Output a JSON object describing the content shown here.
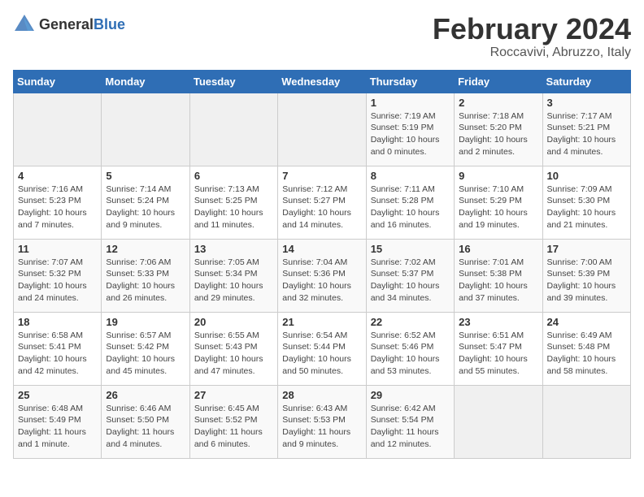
{
  "header": {
    "logo_general": "General",
    "logo_blue": "Blue",
    "title": "February 2024",
    "subtitle": "Roccavivi, Abruzzo, Italy"
  },
  "calendar": {
    "columns": [
      "Sunday",
      "Monday",
      "Tuesday",
      "Wednesday",
      "Thursday",
      "Friday",
      "Saturday"
    ],
    "weeks": [
      [
        {
          "day": "",
          "info": ""
        },
        {
          "day": "",
          "info": ""
        },
        {
          "day": "",
          "info": ""
        },
        {
          "day": "",
          "info": ""
        },
        {
          "day": "1",
          "info": "Sunrise: 7:19 AM\nSunset: 5:19 PM\nDaylight: 10 hours\nand 0 minutes."
        },
        {
          "day": "2",
          "info": "Sunrise: 7:18 AM\nSunset: 5:20 PM\nDaylight: 10 hours\nand 2 minutes."
        },
        {
          "day": "3",
          "info": "Sunrise: 7:17 AM\nSunset: 5:21 PM\nDaylight: 10 hours\nand 4 minutes."
        }
      ],
      [
        {
          "day": "4",
          "info": "Sunrise: 7:16 AM\nSunset: 5:23 PM\nDaylight: 10 hours\nand 7 minutes."
        },
        {
          "day": "5",
          "info": "Sunrise: 7:14 AM\nSunset: 5:24 PM\nDaylight: 10 hours\nand 9 minutes."
        },
        {
          "day": "6",
          "info": "Sunrise: 7:13 AM\nSunset: 5:25 PM\nDaylight: 10 hours\nand 11 minutes."
        },
        {
          "day": "7",
          "info": "Sunrise: 7:12 AM\nSunset: 5:27 PM\nDaylight: 10 hours\nand 14 minutes."
        },
        {
          "day": "8",
          "info": "Sunrise: 7:11 AM\nSunset: 5:28 PM\nDaylight: 10 hours\nand 16 minutes."
        },
        {
          "day": "9",
          "info": "Sunrise: 7:10 AM\nSunset: 5:29 PM\nDaylight: 10 hours\nand 19 minutes."
        },
        {
          "day": "10",
          "info": "Sunrise: 7:09 AM\nSunset: 5:30 PM\nDaylight: 10 hours\nand 21 minutes."
        }
      ],
      [
        {
          "day": "11",
          "info": "Sunrise: 7:07 AM\nSunset: 5:32 PM\nDaylight: 10 hours\nand 24 minutes."
        },
        {
          "day": "12",
          "info": "Sunrise: 7:06 AM\nSunset: 5:33 PM\nDaylight: 10 hours\nand 26 minutes."
        },
        {
          "day": "13",
          "info": "Sunrise: 7:05 AM\nSunset: 5:34 PM\nDaylight: 10 hours\nand 29 minutes."
        },
        {
          "day": "14",
          "info": "Sunrise: 7:04 AM\nSunset: 5:36 PM\nDaylight: 10 hours\nand 32 minutes."
        },
        {
          "day": "15",
          "info": "Sunrise: 7:02 AM\nSunset: 5:37 PM\nDaylight: 10 hours\nand 34 minutes."
        },
        {
          "day": "16",
          "info": "Sunrise: 7:01 AM\nSunset: 5:38 PM\nDaylight: 10 hours\nand 37 minutes."
        },
        {
          "day": "17",
          "info": "Sunrise: 7:00 AM\nSunset: 5:39 PM\nDaylight: 10 hours\nand 39 minutes."
        }
      ],
      [
        {
          "day": "18",
          "info": "Sunrise: 6:58 AM\nSunset: 5:41 PM\nDaylight: 10 hours\nand 42 minutes."
        },
        {
          "day": "19",
          "info": "Sunrise: 6:57 AM\nSunset: 5:42 PM\nDaylight: 10 hours\nand 45 minutes."
        },
        {
          "day": "20",
          "info": "Sunrise: 6:55 AM\nSunset: 5:43 PM\nDaylight: 10 hours\nand 47 minutes."
        },
        {
          "day": "21",
          "info": "Sunrise: 6:54 AM\nSunset: 5:44 PM\nDaylight: 10 hours\nand 50 minutes."
        },
        {
          "day": "22",
          "info": "Sunrise: 6:52 AM\nSunset: 5:46 PM\nDaylight: 10 hours\nand 53 minutes."
        },
        {
          "day": "23",
          "info": "Sunrise: 6:51 AM\nSunset: 5:47 PM\nDaylight: 10 hours\nand 55 minutes."
        },
        {
          "day": "24",
          "info": "Sunrise: 6:49 AM\nSunset: 5:48 PM\nDaylight: 10 hours\nand 58 minutes."
        }
      ],
      [
        {
          "day": "25",
          "info": "Sunrise: 6:48 AM\nSunset: 5:49 PM\nDaylight: 11 hours\nand 1 minute."
        },
        {
          "day": "26",
          "info": "Sunrise: 6:46 AM\nSunset: 5:50 PM\nDaylight: 11 hours\nand 4 minutes."
        },
        {
          "day": "27",
          "info": "Sunrise: 6:45 AM\nSunset: 5:52 PM\nDaylight: 11 hours\nand 6 minutes."
        },
        {
          "day": "28",
          "info": "Sunrise: 6:43 AM\nSunset: 5:53 PM\nDaylight: 11 hours\nand 9 minutes."
        },
        {
          "day": "29",
          "info": "Sunrise: 6:42 AM\nSunset: 5:54 PM\nDaylight: 11 hours\nand 12 minutes."
        },
        {
          "day": "",
          "info": ""
        },
        {
          "day": "",
          "info": ""
        }
      ]
    ]
  }
}
